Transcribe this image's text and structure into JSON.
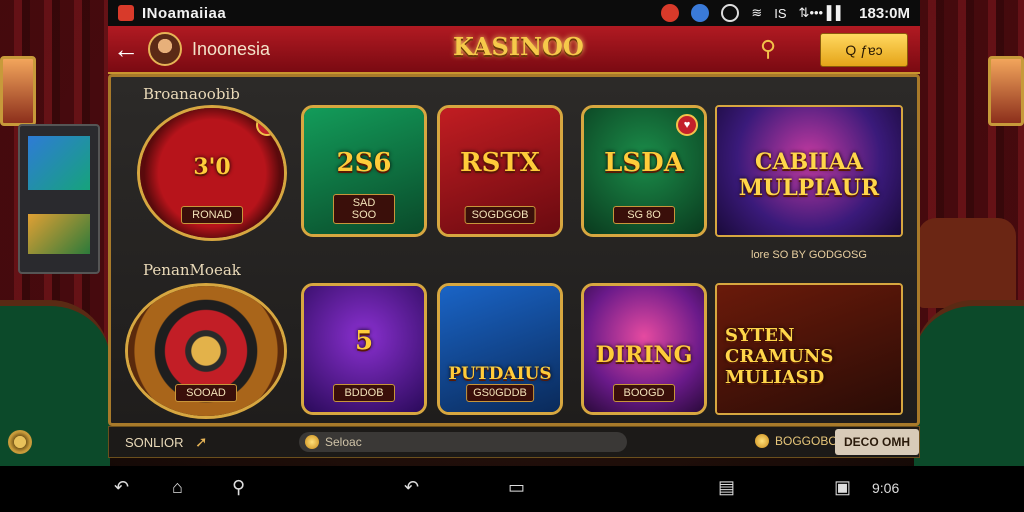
{
  "status_bar": {
    "app_title": "INoamaiiaa",
    "signal": "IS",
    "network": "⇅••• ▌▌",
    "time": "183:0M"
  },
  "header": {
    "back_icon": "arrow-left-icon",
    "region": "Inoonesia",
    "brand": "KASINOO",
    "search_icon": "search-icon",
    "search_button_label": "Q ƒɐɔ"
  },
  "sections": [
    {
      "title": "Broanaoobib"
    },
    {
      "title": "PenanMoeak"
    }
  ],
  "tiles": [
    {
      "name": "3'0",
      "tag": "RONAD",
      "mark": "♥"
    },
    {
      "name": "2S6",
      "tag": "SAD SOO"
    },
    {
      "name": "RSTX",
      "tag": "SOGDGOB"
    },
    {
      "name": "LSDA",
      "tag": "SG 8O",
      "mark": "♥"
    },
    {
      "name": "CABIIAA MULPIAUR",
      "tag": ""
    },
    {
      "name": "",
      "tag": "SOOAD"
    },
    {
      "name": "5",
      "tag": "BDDOB"
    },
    {
      "name": "PUTDAIUS",
      "tag": "GS0GDDB"
    },
    {
      "name": "DIRING",
      "tag": "BOOGD"
    },
    {
      "name": "SYTEN CRAMUNS MULIASD",
      "tag": ""
    }
  ],
  "promo_text": "lore SO BY GODGOSG",
  "bottom_bar": {
    "label": "SONLIOR",
    "arrow": "➚",
    "search_text": "Seloac",
    "balance": "BOGGOBO",
    "button_label": "DECO OMH"
  },
  "nav": {
    "back": "↶",
    "home": "⌂",
    "pin": "⚲",
    "back2": "↶",
    "overview": "▭",
    "apps": "▤",
    "recent": "▣",
    "clock": "9:06"
  }
}
